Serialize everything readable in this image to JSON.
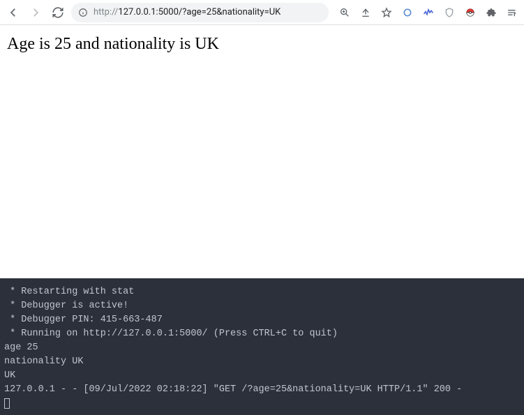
{
  "toolbar": {
    "url_proto": "http://",
    "url_rest": "127.0.0.1:5000/?age=25&nationality=UK"
  },
  "page": {
    "heading": "Age is 25 and nationality is UK"
  },
  "terminal": {
    "lines": [
      " * Restarting with stat",
      " * Debugger is active!",
      " * Debugger PIN: 415-663-487",
      " * Running on http://127.0.0.1:5000/ (Press CTRL+C to quit)",
      "age 25",
      "nationality UK",
      "UK",
      "127.0.0.1 - - [09/Jul/2022 02:18:22] \"GET /?age=25&nationality=UK HTTP/1.1\" 200 -"
    ]
  }
}
